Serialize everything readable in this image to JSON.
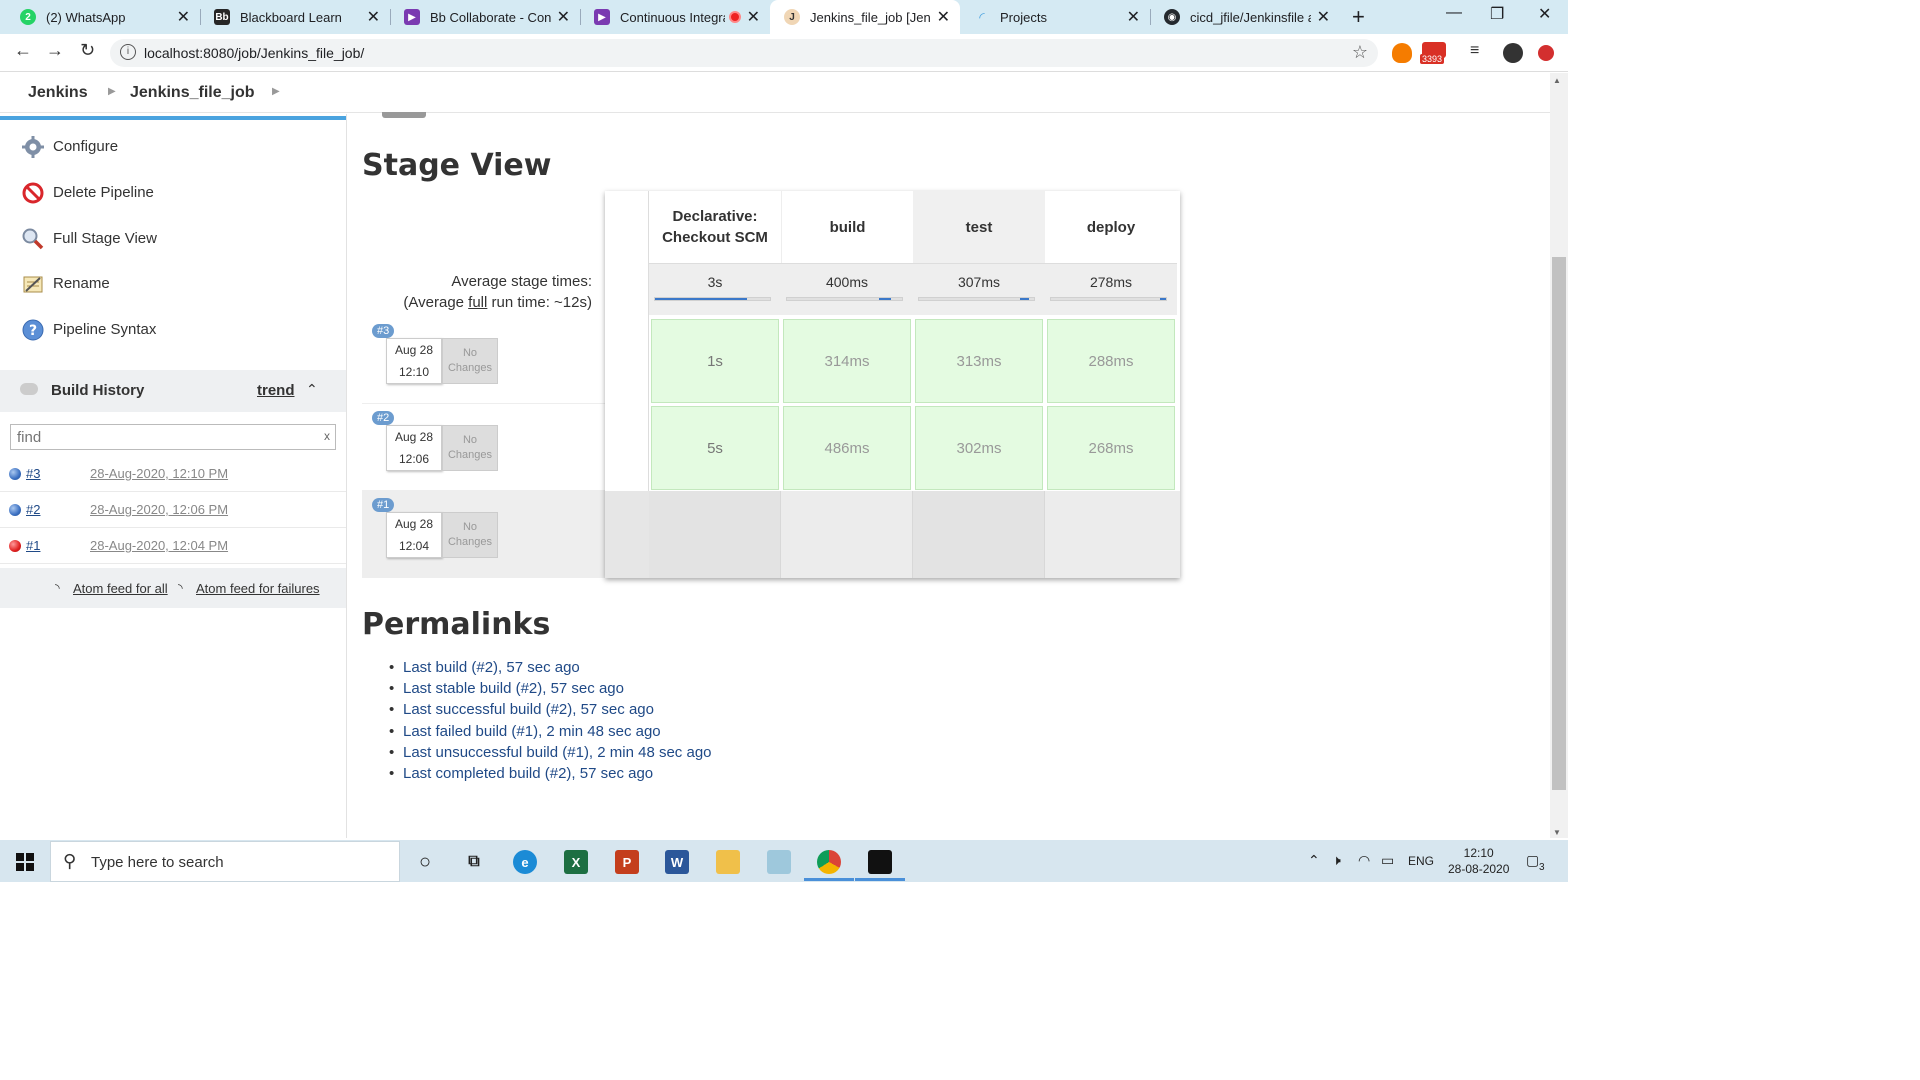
{
  "browser": {
    "tabs": [
      {
        "title": "(2) WhatsApp",
        "icon": "whatsapp-icon",
        "color": "#25d366"
      },
      {
        "title": "Blackboard Learn",
        "icon": "blackboard-icon",
        "color": "#262626"
      },
      {
        "title": "Bb Collaborate - Conti",
        "icon": "collaborate-icon",
        "color": "#7a3ab1"
      },
      {
        "title": "Continuous Integra",
        "icon": "collaborate-icon",
        "color": "#7a3ab1"
      },
      {
        "title": "Jenkins_file_job [Jenkin",
        "icon": "jenkins-icon",
        "color": "#d33833"
      },
      {
        "title": "Projects",
        "icon": "projects-icon",
        "color": "#4aa3df"
      },
      {
        "title": "cicd_jfile/Jenkinsfile at",
        "icon": "github-icon",
        "color": "#24292e"
      }
    ],
    "url": "localhost:8080/job/Jenkins_file_job/",
    "gmail_badge": "3393"
  },
  "breadcrumb": [
    "Jenkins",
    "Jenkins_file_job"
  ],
  "sidebar": {
    "tasks": [
      {
        "label": "Configure",
        "icon": "gear-icon"
      },
      {
        "label": "Delete Pipeline",
        "icon": "no-entry-icon"
      },
      {
        "label": "Full Stage View",
        "icon": "search-icon"
      },
      {
        "label": "Rename",
        "icon": "notepad-icon"
      },
      {
        "label": "Pipeline Syntax",
        "icon": "help-icon"
      }
    ],
    "build_history": {
      "title": "Build History",
      "trend": "trend",
      "find_placeholder": "find",
      "find_clear": "x",
      "builds": [
        {
          "number": "#3",
          "date": "28-Aug-2020, 12:10 PM",
          "status": "success"
        },
        {
          "number": "#2",
          "date": "28-Aug-2020, 12:06 PM",
          "status": "success"
        },
        {
          "number": "#1",
          "date": "28-Aug-2020, 12:04 PM",
          "status": "failed"
        }
      ],
      "feed_all": "Atom feed for all",
      "feed_failures": "Atom feed for failures"
    }
  },
  "stage_view": {
    "title": "Stage View",
    "avg_label_1": "Average stage times:",
    "avg_label_2_prefix": "(Average ",
    "avg_label_2_link": "full",
    "avg_label_2_suffix": " run time: ~12s)",
    "stages": [
      {
        "name_1": "Declarative:",
        "name_2": "Checkout SCM",
        "avg": "3s",
        "bar_start": 0.0,
        "bar_fraction": 0.8
      },
      {
        "name_1": "build",
        "name_2": "",
        "avg": "400ms",
        "bar_start": 0.8,
        "bar_fraction": 0.1
      },
      {
        "name_1": "test",
        "name_2": "",
        "avg": "307ms",
        "bar_start": 0.88,
        "bar_fraction": 0.08
      },
      {
        "name_1": "deploy",
        "name_2": "",
        "avg": "278ms",
        "bar_start": 0.95,
        "bar_fraction": 0.05
      }
    ],
    "runs": [
      {
        "badge": "#3",
        "date": "Aug 28",
        "time": "12:10",
        "changes_1": "No",
        "changes_2": "Changes",
        "times": [
          "1s",
          "314ms",
          "313ms",
          "288ms"
        ]
      },
      {
        "badge": "#2",
        "date": "Aug 28",
        "time": "12:06",
        "changes_1": "No",
        "changes_2": "Changes",
        "times": [
          "5s",
          "486ms",
          "302ms",
          "268ms"
        ]
      },
      {
        "badge": "#1",
        "date": "Aug 28",
        "time": "12:04",
        "changes_1": "No",
        "changes_2": "Changes",
        "times": []
      }
    ]
  },
  "permalinks": {
    "title": "Permalinks",
    "items": [
      "Last build (#2), 57 sec ago",
      "Last stable build (#2), 57 sec ago",
      "Last successful build (#2), 57 sec ago",
      "Last failed build (#1), 2 min 48 sec ago",
      "Last unsuccessful build (#1), 2 min 48 sec ago",
      "Last completed build (#2), 57 sec ago"
    ]
  },
  "taskbar": {
    "search_placeholder": "Type here to search",
    "language": "ENG",
    "time": "12:10",
    "date": "28-08-2020",
    "notifications": "3"
  },
  "colors": {
    "success_cell": "#e4fbe1",
    "link": "#204a87",
    "accent": "#4aa3df",
    "tabbar": "#d5eaf3"
  }
}
